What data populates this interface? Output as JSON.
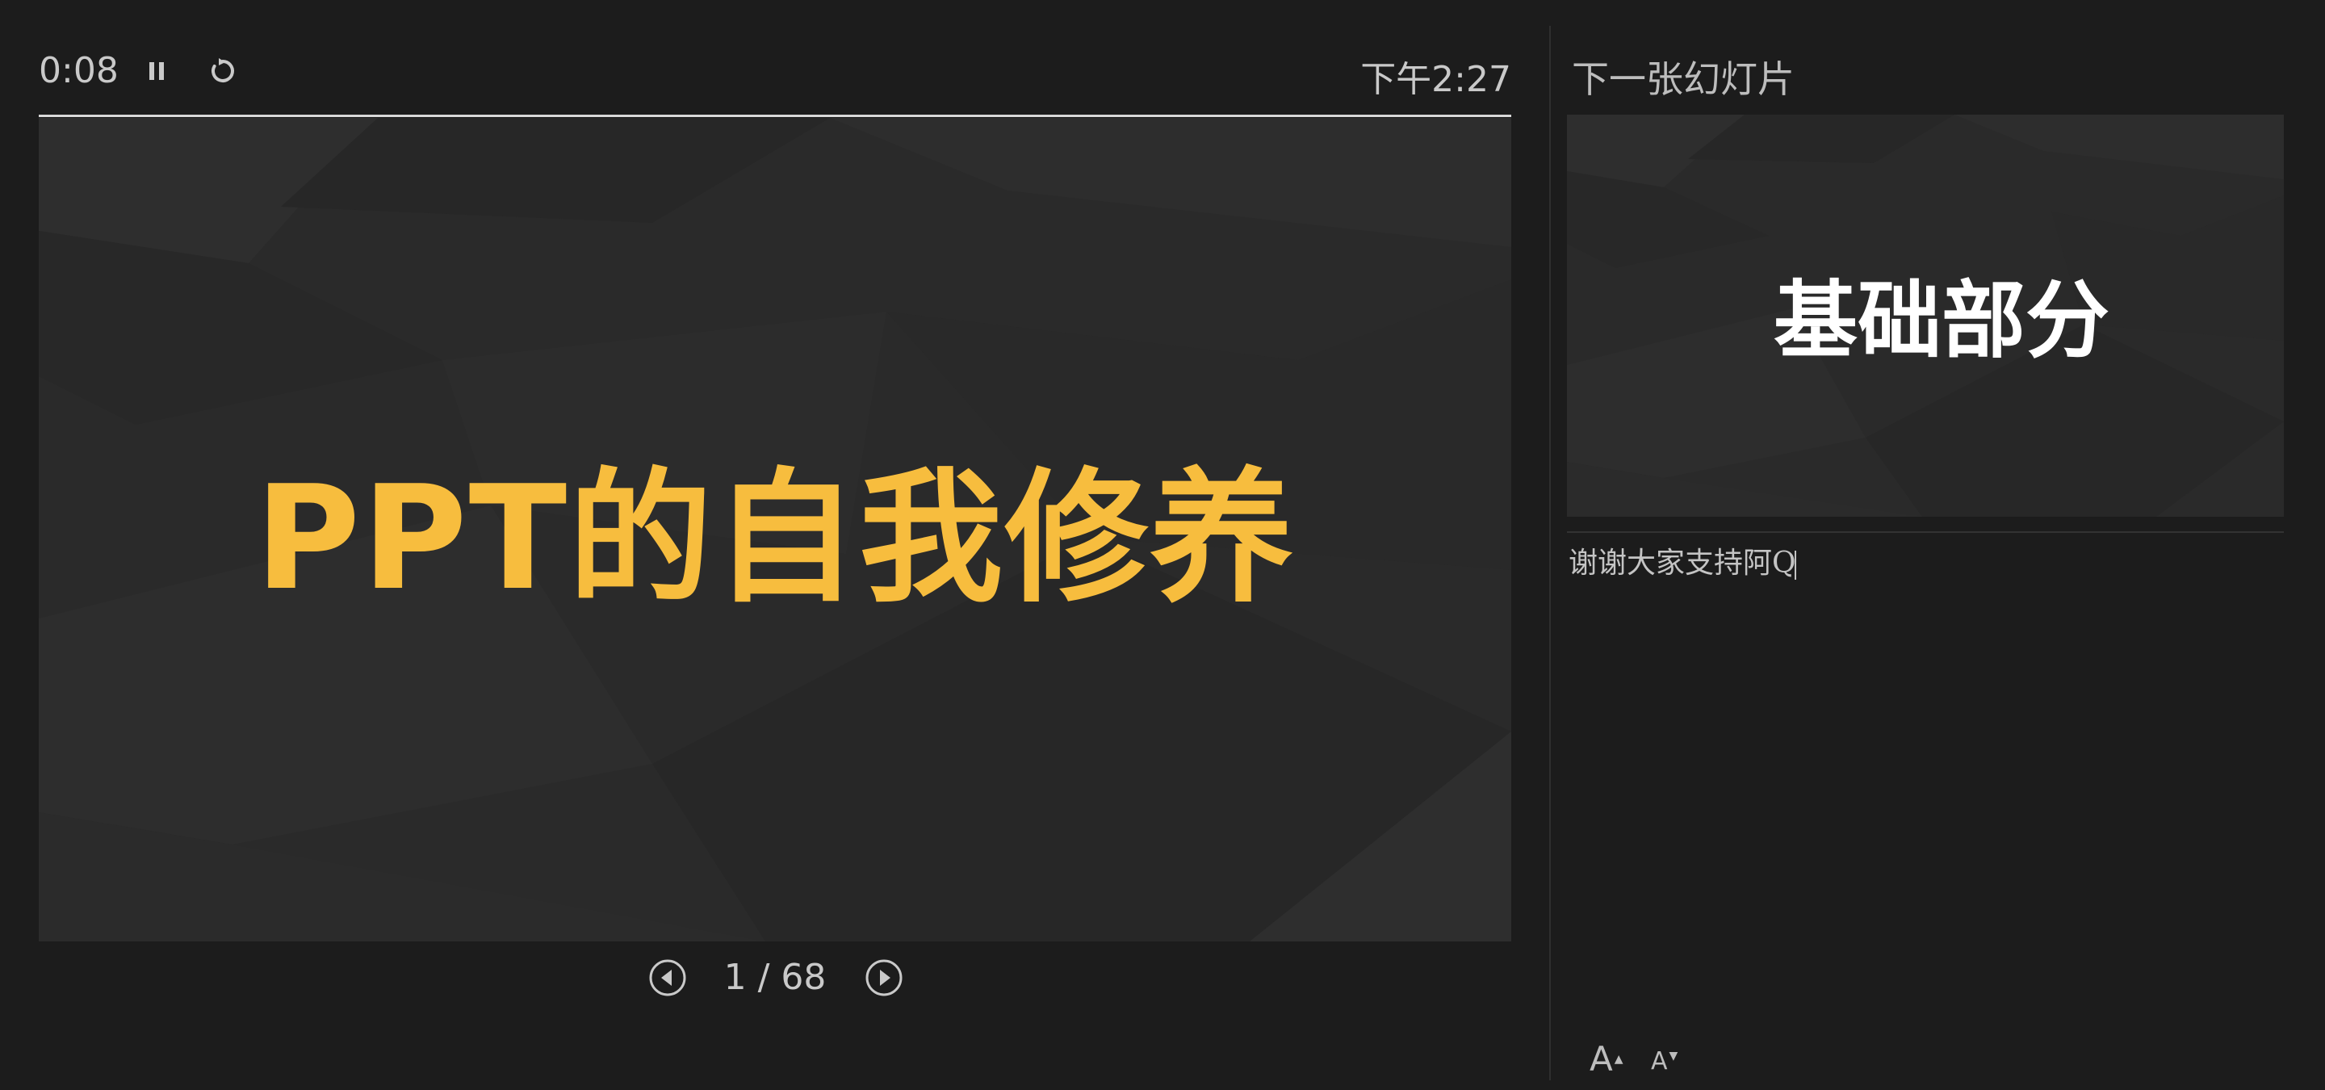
{
  "presenter": {
    "timer": "0:08",
    "clock": "下午2:27",
    "current_slide": {
      "title": "PPT的自我修养"
    },
    "navigation": {
      "page_indicator": "1 / 68"
    },
    "next_slide": {
      "label": "下一张幻灯片",
      "title": "基础部分"
    },
    "notes": {
      "text": "谢谢大家支持阿Q"
    },
    "icons": {
      "pause": "pause-icon",
      "reset": "reset-icon",
      "prev": "prev-slide-icon",
      "next": "next-slide-icon",
      "font_up": "font-increase-icon",
      "font_down": "font-decrease-icon"
    },
    "colors": {
      "background": "#1c1c1c",
      "slide_background": "#2a2a2a",
      "title_accent": "#f7bd3e",
      "text_secondary": "#c9c9c9"
    }
  }
}
